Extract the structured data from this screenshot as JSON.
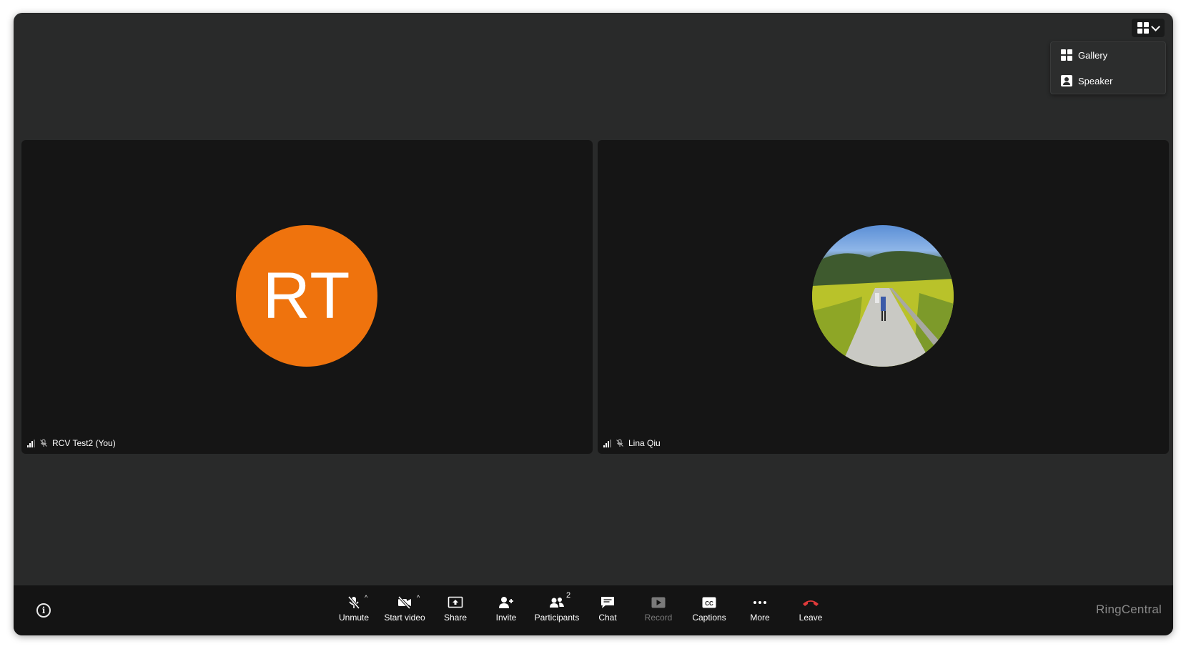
{
  "layout_menu": {
    "items": [
      {
        "label": "Gallery",
        "icon": "gallery-grid-icon"
      },
      {
        "label": "Speaker",
        "icon": "speaker-view-icon"
      }
    ]
  },
  "participants": [
    {
      "name": "RCV Test2 (You)",
      "initials": "RT",
      "avatar_color": "#ef730d",
      "muted": true
    },
    {
      "name": "Lina Qiu",
      "avatar": "photo",
      "muted": true
    }
  ],
  "toolbar": {
    "unmute": "Unmute",
    "start_video": "Start video",
    "share": "Share",
    "invite": "Invite",
    "participants": "Participants",
    "participants_count": "2",
    "chat": "Chat",
    "record": "Record",
    "captions": "Captions",
    "more": "More",
    "leave": "Leave",
    "leave_color": "#e03a3a"
  },
  "brand": "RingCentral"
}
